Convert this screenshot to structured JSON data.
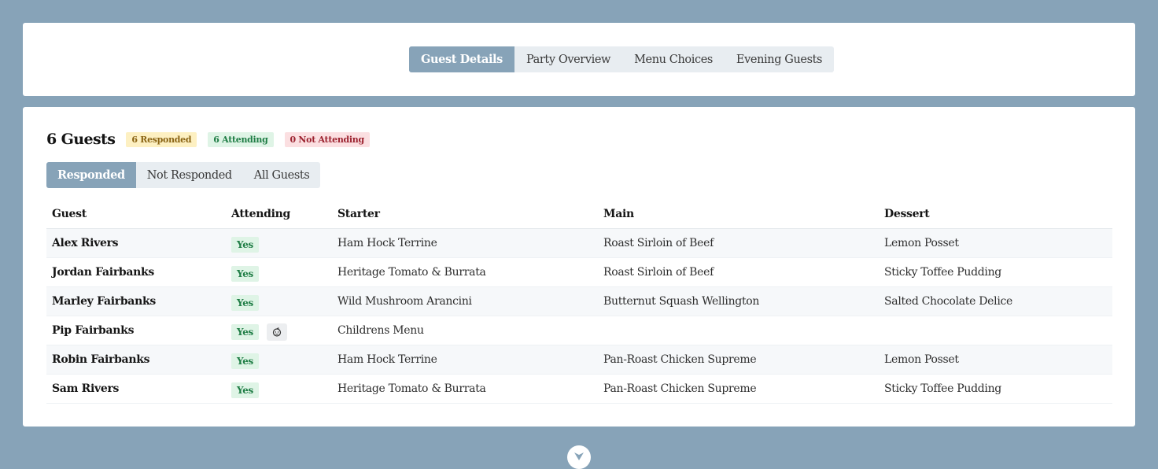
{
  "main_tabs": {
    "guest_details": "Guest Details",
    "party_overview": "Party Overview",
    "menu_choices": "Menu Choices",
    "evening_guests": "Evening Guests"
  },
  "summary": {
    "guest_count": "6 Guests",
    "responded": "6 Responded",
    "attending": "6 Attending",
    "not_attending": "0 Not Attending"
  },
  "filter_tabs": {
    "responded": "Responded",
    "not_responded": "Not Responded",
    "all_guests": "All Guests"
  },
  "table": {
    "headers": {
      "guest": "Guest",
      "attending": "Attending",
      "starter": "Starter",
      "main": "Main",
      "dessert": "Dessert"
    },
    "rows": [
      {
        "guest": "Alex Rivers",
        "attending": "Yes",
        "starter": "Ham Hock Terrine",
        "main": "Roast Sirloin of Beef",
        "dessert": "Lemon Posset"
      },
      {
        "guest": "Jordan Fairbanks",
        "attending": "Yes",
        "starter": "Heritage Tomato & Burrata",
        "main": "Roast Sirloin of Beef",
        "dessert": "Sticky Toffee Pudding"
      },
      {
        "guest": "Marley Fairbanks",
        "attending": "Yes",
        "starter": "Wild Mushroom Arancini",
        "main": "Butternut Squash Wellington",
        "dessert": "Salted Chocolate Delice"
      },
      {
        "guest": "Pip Fairbanks",
        "attending": "Yes",
        "child_icon": "child-icon",
        "starter": "Childrens Menu",
        "main": "",
        "dessert": ""
      },
      {
        "guest": "Robin Fairbanks",
        "attending": "Yes",
        "starter": "Ham Hock Terrine",
        "main": "Pan-Roast Chicken Supreme",
        "dessert": "Lemon Posset"
      },
      {
        "guest": "Sam Rivers",
        "attending": "Yes",
        "starter": "Heritage Tomato & Burrata",
        "main": "Pan-Roast Chicken Supreme",
        "dessert": "Sticky Toffee Pudding"
      }
    ]
  },
  "scroll_icon": "chevron-down-icon",
  "colors": {
    "background": "#87a3b8",
    "accent": "#87a3b8",
    "yes_badge_bg": "#dff4e6",
    "yes_badge_text": "#1f7d45"
  }
}
